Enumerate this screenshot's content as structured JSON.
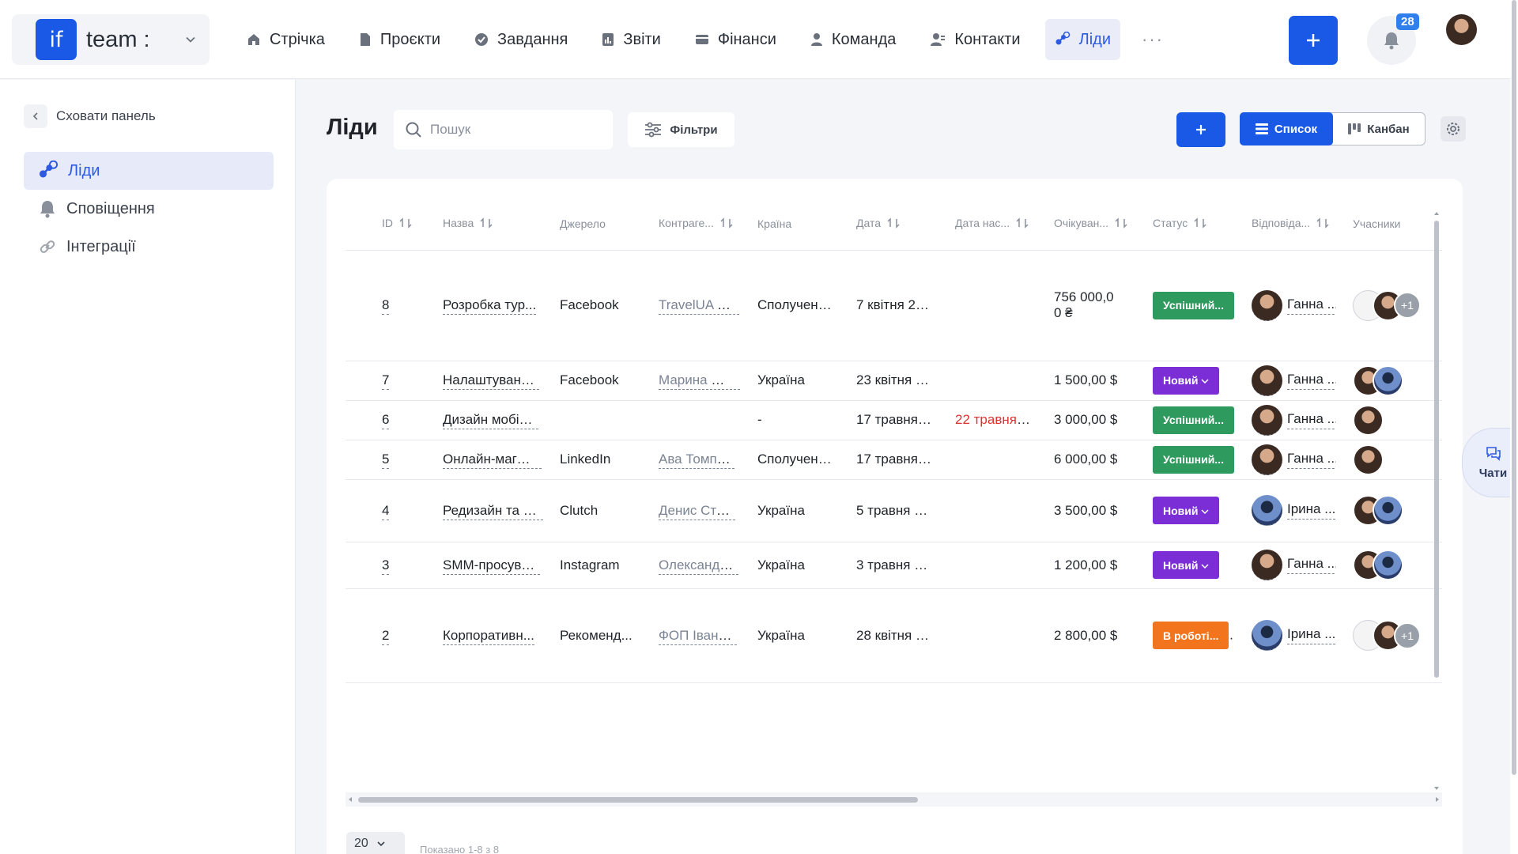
{
  "app": {
    "logo_text": "if",
    "name": "team :"
  },
  "nav": [
    {
      "label": "Стрічка",
      "icon": "home-icon"
    },
    {
      "label": "Проєкти",
      "icon": "document-icon"
    },
    {
      "label": "Завдання",
      "icon": "check-circle-icon"
    },
    {
      "label": "Звіти",
      "icon": "report-icon"
    },
    {
      "label": "Фінанси",
      "icon": "wallet-icon"
    },
    {
      "label": "Команда",
      "icon": "user-icon"
    },
    {
      "label": "Контакти",
      "icon": "contacts-icon"
    },
    {
      "label": "Ліди",
      "icon": "leads-icon",
      "active": true
    }
  ],
  "nav_more": "···",
  "notifications_count": "28",
  "sidebar": {
    "hide_label": "Сховати панель",
    "items": [
      {
        "label": "Ліди",
        "active": true
      },
      {
        "label": "Сповіщення"
      },
      {
        "label": "Інтеграції"
      }
    ]
  },
  "page": {
    "title": "Ліди",
    "search_placeholder": "Пошук",
    "filters_label": "Фільтри",
    "view_list": "Список",
    "view_kanban": "Канбан"
  },
  "table": {
    "columns": [
      "ID",
      "Назва",
      "Джерело",
      "Контраге...",
      "Країна",
      "Дата",
      "Дата нас...",
      "Очікуван...",
      "Статус",
      "Відповіда...",
      "Учасники"
    ],
    "rows": [
      {
        "id": "8",
        "name": "Розробка тур...",
        "source": "Facebook",
        "counterparty": "TravelUA LL...",
        "country": "Сполучені ...",
        "date": "7 квітня 20...",
        "next_date": "",
        "expected": "756 000,0\n0 ₴",
        "status": "Успішний...",
        "status_type": "success",
        "responsible": "Ганна ...",
        "resp_avatar": "brown",
        "participants": [
          "sketch",
          "brown"
        ],
        "extra": "+1"
      },
      {
        "id": "7",
        "name": "Налаштуванн...",
        "source": "Facebook",
        "counterparty": "Марина Ор...",
        "country": "Україна",
        "date": "23 квітня 2...",
        "next_date": "",
        "expected": "1 500,00 $",
        "status": "Новий",
        "status_type": "new",
        "responsible": "Ганна ...",
        "resp_avatar": "brown",
        "participants": [
          "brown",
          "blue"
        ],
        "extra": ""
      },
      {
        "id": "6",
        "name": "Дизайн мобіл...",
        "source": "",
        "counterparty": "",
        "country": "-",
        "date": "17 травня 2...",
        "next_date": "22 травня, ...",
        "expected": "3 000,00 $",
        "status": "Успішний...",
        "status_type": "success",
        "responsible": "Ганна ...",
        "resp_avatar": "brown",
        "participants": [
          "brown"
        ],
        "extra": ""
      },
      {
        "id": "5",
        "name": "Онлайн-магаз...",
        "source": "LinkedIn",
        "counterparty": "Ава Томпс...",
        "country": "Сполучені ...",
        "date": "17 травня 2...",
        "next_date": "",
        "expected": "6 000,00 $",
        "status": "Успішний...",
        "status_type": "success",
        "responsible": "Ганна ...",
        "resp_avatar": "brown",
        "participants": [
          "brown"
        ],
        "extra": ""
      },
      {
        "id": "4",
        "name": "Редизайн та S...",
        "source": "Clutch",
        "counterparty": "Денис Ста...",
        "country": "Україна",
        "date": "5 травня 2...",
        "next_date": "",
        "expected": "3 500,00 $",
        "status": "Новий",
        "status_type": "new",
        "responsible": "Ірина ...",
        "resp_avatar": "blue",
        "participants": [
          "brown",
          "blue"
        ],
        "extra": ""
      },
      {
        "id": "3",
        "name": "SMM-просува...",
        "source": "Instagram",
        "counterparty": "Олександр...",
        "country": "Україна",
        "date": "3 травня 2...",
        "next_date": "",
        "expected": "1 200,00 $",
        "status": "Новий",
        "status_type": "new",
        "responsible": "Ганна ...",
        "resp_avatar": "brown",
        "participants": [
          "brown",
          "blue"
        ],
        "extra": ""
      },
      {
        "id": "2",
        "name": "Корпоративн...",
        "source": "Рекоменд...",
        "counterparty": "ФОП Івано...",
        "country": "Україна",
        "date": "28 квітня 2...",
        "next_date": "",
        "expected": "2 800,00 $",
        "status": "В роботі...",
        "status_type": "work",
        "responsible": "Ірина ...",
        "resp_avatar": "blue",
        "participants": [
          "sketch",
          "brown"
        ],
        "extra": "+1"
      }
    ]
  },
  "pager": {
    "page_size": "20",
    "info": "Показано 1-8 з 8"
  },
  "chats_label": "Чати",
  "colors": {
    "primary": "#1a59e6",
    "success": "#2e9a5e",
    "new": "#7b2ed6",
    "work": "#f2741c",
    "overdue": "#e0322f"
  }
}
